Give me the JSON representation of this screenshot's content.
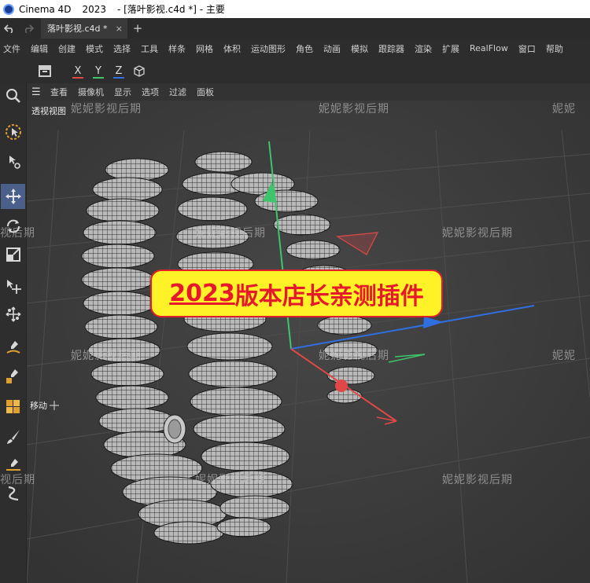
{
  "titlebar": {
    "app_name": "Cinema 4D",
    "version": "2023",
    "document": "- [落叶影视.c4d *] - 主要"
  },
  "tabs": {
    "doc_tab": "落叶影视.c4d *",
    "close": "×",
    "new_tab": "+"
  },
  "menu": [
    "文件",
    "编辑",
    "创建",
    "模式",
    "选择",
    "工具",
    "样条",
    "网格",
    "体积",
    "运动图形",
    "角色",
    "动画",
    "模拟",
    "跟踪器",
    "渲染",
    "扩展",
    "RealFlow",
    "窗口",
    "帮助"
  ],
  "toolbar": {
    "x_label": "X",
    "y_label": "Y",
    "z_label": "Z"
  },
  "viewport": {
    "menu": [
      "查看",
      "摄像机",
      "显示",
      "选项",
      "过滤",
      "面板"
    ],
    "view_label": "透视视图",
    "move_label": "移动"
  },
  "banner": {
    "number": "2023",
    "text": "版本店长亲测插件"
  },
  "watermark": "妮妮影视后期",
  "watermark_clipped_right": "妮妮",
  "watermark_clipped_left": "视后期",
  "colors": {
    "x_axis": "#e04848",
    "y_axis": "#3ec46b",
    "z_axis": "#2f6fe0",
    "banner_bg": "#fff227",
    "banner_text": "#e5192b",
    "active_tool": "#4a5f8a"
  }
}
